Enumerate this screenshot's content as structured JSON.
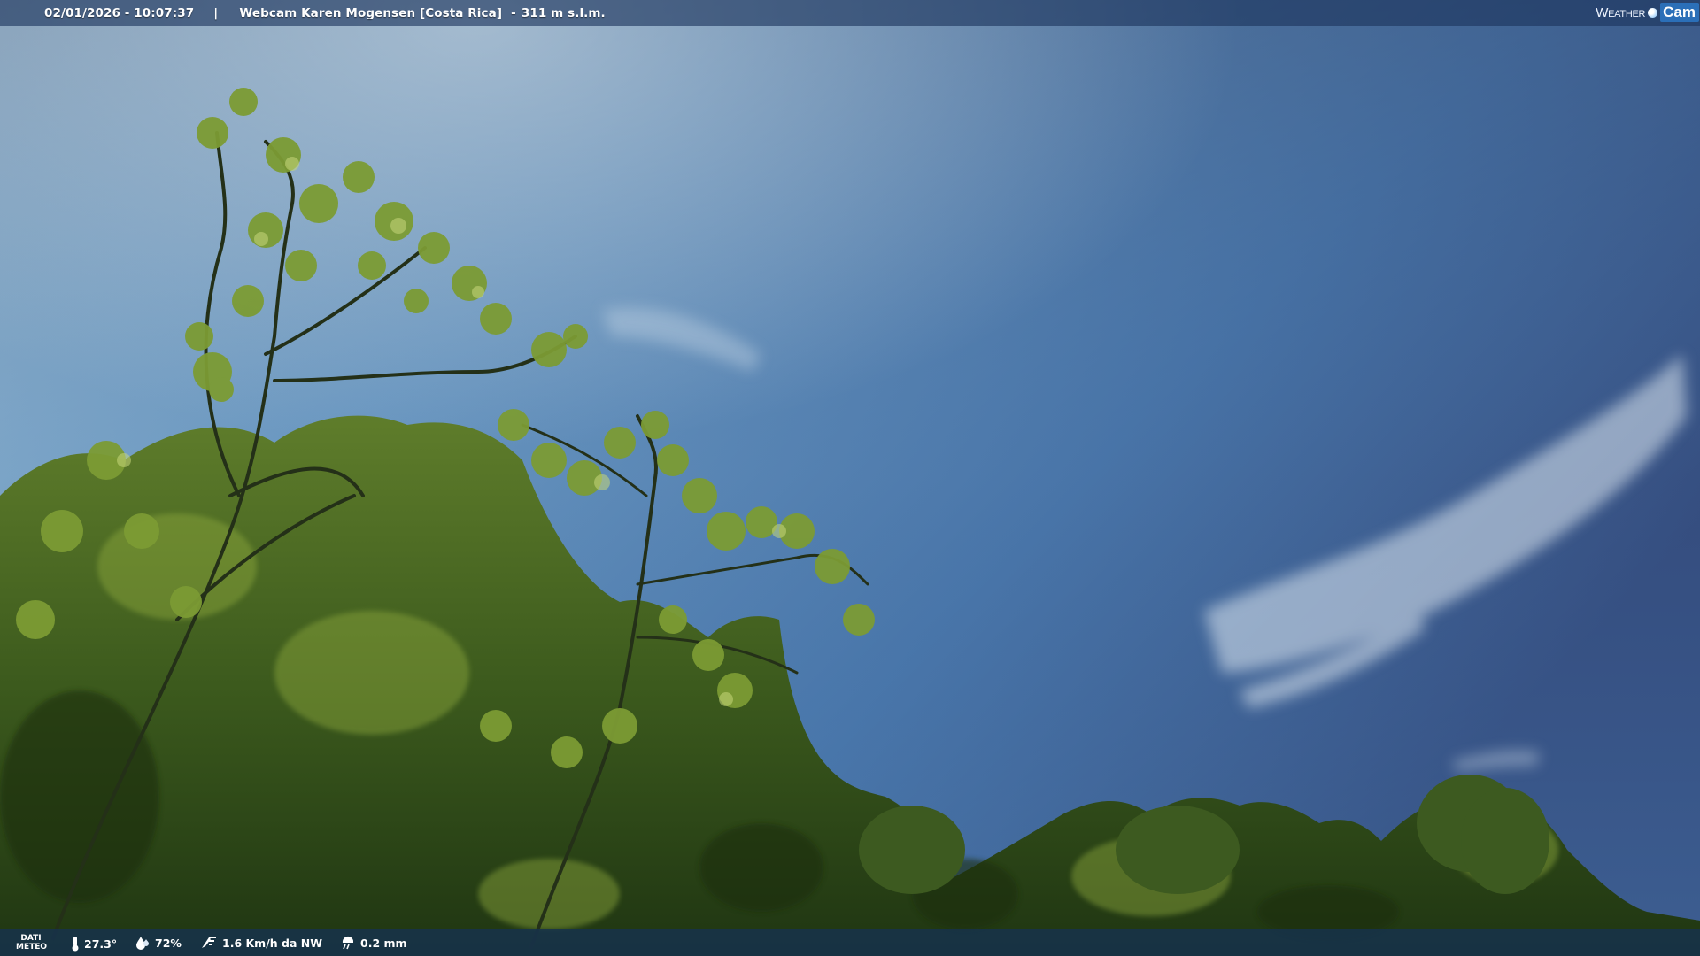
{
  "header": {
    "datetime": "02/01/2026 - 10:07:37",
    "separator": "|",
    "webcam_name": "Webcam Karen Mogensen [Costa Rica]",
    "dash": "-",
    "altitude": "311 m s.l.m."
  },
  "logo": {
    "weather": "Weather",
    "cam": "Cam",
    "icon": "globe-icon"
  },
  "weather_bar": {
    "label_line1": "DATI",
    "label_line2": "METEO",
    "temperature": "27.3°",
    "humidity": "72%",
    "wind": "1.6 Km/h da NW",
    "rain": "0.2 mm",
    "icons": [
      "thermometer-icon",
      "humidity-drop-icon",
      "wind-icon",
      "rain-icon"
    ]
  },
  "colors": {
    "sky_top_left": "#a9c6d8",
    "sky_top_right": "#34476f",
    "sky_mid": "#4a7fb4",
    "foliage_dark": "#1f3a14",
    "foliage_light": "#9fb847",
    "bar_bg": "#1c345c"
  }
}
